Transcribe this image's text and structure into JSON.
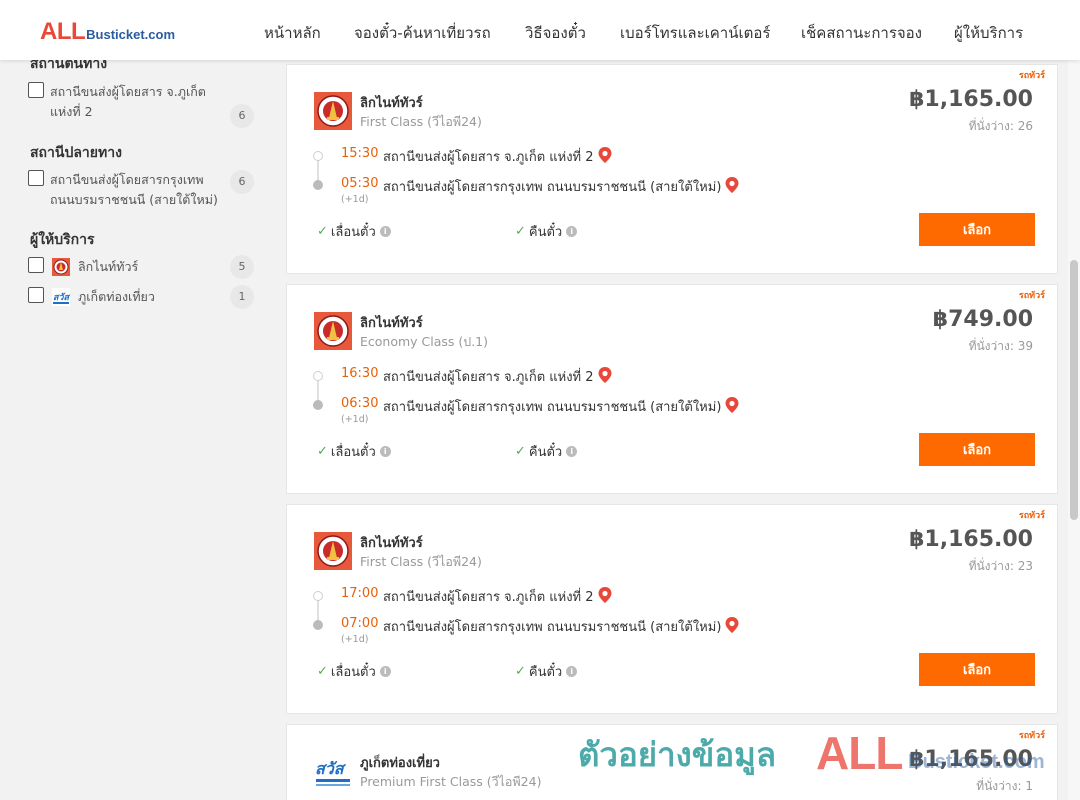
{
  "header": {
    "logo_all": "ALL",
    "logo_rest": "Busticket.com",
    "nav": [
      "หน้าหลัก",
      "จองตั๋ว-ค้นหาเที่ยวรถ",
      "วิธีจองตั๋ว",
      "เบอร์โทรและเคาน์เตอร์",
      "เช็คสถานะการจอง",
      "ผู้ให้บริการ"
    ]
  },
  "sidebar": {
    "origin_title": "สถานีต้นทาง",
    "origin_items": [
      {
        "label": "สถานีขนส่งผู้โดยสาร จ.ภูเก็ต แห่งที่ 2",
        "count": "6"
      }
    ],
    "dest_title": "สถานีปลายทาง",
    "dest_items": [
      {
        "label": "สถานีขนส่งผู้โดยสารกรุงเทพ ถนนบรมราชชนนี (สายใต้ใหม่)",
        "count": "6"
      }
    ],
    "operator_title": "ผู้ให้บริการ",
    "operator_items": [
      {
        "label": "ลิกไนท์ทัวร์",
        "count": "5",
        "logo": "lignite-tour-logo"
      },
      {
        "label": "ภูเก็ตท่องเที่ยว",
        "count": "1",
        "logo": "phuket-travel-logo"
      }
    ]
  },
  "trips": [
    {
      "badge": "รถทัวร์",
      "operator": "ลิกไนท์ทัวร์",
      "class": "First Class (วีไอพี24)",
      "price": "฿1,165.00",
      "seats": "ที่นั่งว่าง: 26",
      "depart_time": "15:30",
      "depart_station": "สถานีขนส่งผู้โดยสาร จ.ภูเก็ต แห่งที่ 2",
      "arrive_time": "05:30",
      "arrive_station": "สถานีขนส่งผู้โดยสารกรุงเทพ ถนนบรมราชชนนี (สายใต้ใหม่)",
      "day_offset": "(+1d)",
      "feature_1": "เลื่อนตั๋ว",
      "feature_2": "คืนตั๋ว",
      "button": "เลือก"
    },
    {
      "badge": "รถทัวร์",
      "operator": "ลิกไนท์ทัวร์",
      "class": "Economy Class (ป.1)",
      "price": "฿749.00",
      "seats": "ที่นั่งว่าง: 39",
      "depart_time": "16:30",
      "depart_station": "สถานีขนส่งผู้โดยสาร จ.ภูเก็ต แห่งที่ 2",
      "arrive_time": "06:30",
      "arrive_station": "สถานีขนส่งผู้โดยสารกรุงเทพ ถนนบรมราชชนนี (สายใต้ใหม่)",
      "day_offset": "(+1d)",
      "feature_1": "เลื่อนตั๋ว",
      "feature_2": "คืนตั๋ว",
      "button": "เลือก"
    },
    {
      "badge": "รถทัวร์",
      "operator": "ลิกไนท์ทัวร์",
      "class": "First Class (วีไอพี24)",
      "price": "฿1,165.00",
      "seats": "ที่นั่งว่าง: 23",
      "depart_time": "17:00",
      "depart_station": "สถานีขนส่งผู้โดยสาร จ.ภูเก็ต แห่งที่ 2",
      "arrive_time": "07:00",
      "arrive_station": "สถานีขนส่งผู้โดยสารกรุงเทพ ถนนบรมราชชนนี (สายใต้ใหม่)",
      "day_offset": "(+1d)",
      "feature_1": "เลื่อนตั๋ว",
      "feature_2": "คืนตั๋ว",
      "button": "เลือก"
    },
    {
      "badge": "รถทัวร์",
      "operator": "ภูเก็ตท่องเที่ยว",
      "class": "Premium First Class (วีไอพี24)",
      "price": "฿1,165.00",
      "seats": "ที่นั่งว่าง: 1"
    }
  ],
  "watermark": {
    "text": "ตัวอย่างข้อมูล",
    "logo_all": "ALL",
    "logo_rest": "Busticket.com"
  },
  "colors": {
    "accent": "#ff6a00",
    "time": "#e8600a",
    "brand_red": "#e8483a",
    "brand_blue": "#2a5d9f"
  }
}
